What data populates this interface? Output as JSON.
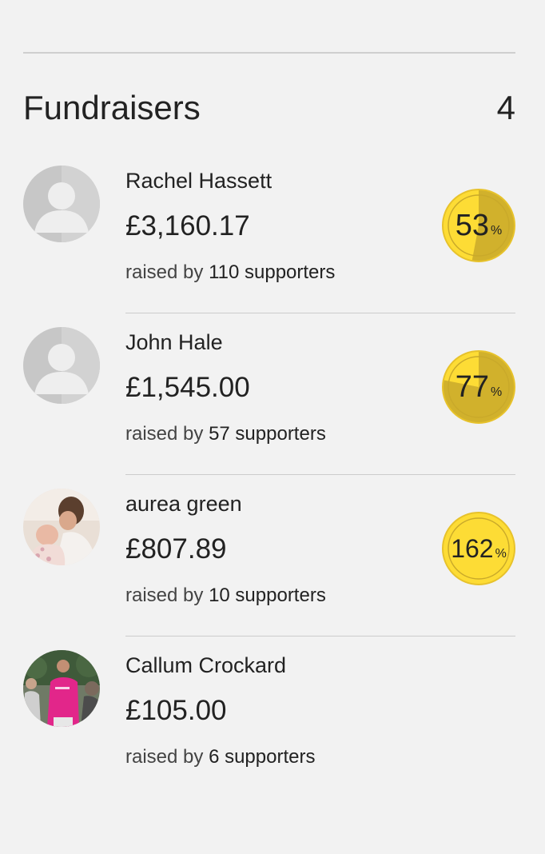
{
  "header": {
    "title": "Fundraisers",
    "count": "4"
  },
  "fundraisers": [
    {
      "name": "Rachel Hassett",
      "amount": "£3,160.17",
      "raised_by": "raised by",
      "supporters": "110 supporters",
      "percent": "53",
      "percent_sign": "%",
      "avatar": "placeholder-avatar-icon"
    },
    {
      "name": "John Hale",
      "amount": "£1,545.00",
      "raised_by": "raised by",
      "supporters": "57 supporters",
      "percent": "77",
      "percent_sign": "%",
      "avatar": "placeholder-avatar-icon"
    },
    {
      "name": "aurea green",
      "amount": "£807.89",
      "raised_by": "raised by",
      "supporters": "10 supporters",
      "percent": "162",
      "percent_sign": "%",
      "avatar": "photo-avatar"
    },
    {
      "name": "Callum Crockard",
      "amount": "£105.00",
      "raised_by": "raised by",
      "supporters": "6 supporters",
      "avatar": "photo-avatar"
    }
  ],
  "colors": {
    "background": "#f2f2f2",
    "badge_fill": "#fddc35",
    "badge_progress": "#c9a92a",
    "badge_ring": "#e7c22b",
    "placeholder_avatar": "#c7c7c7"
  }
}
